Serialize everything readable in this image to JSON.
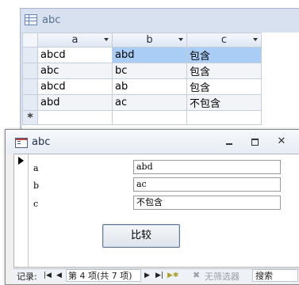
{
  "table_window": {
    "title": "abc",
    "columns": [
      "a",
      "b",
      "c"
    ],
    "rows": [
      [
        "abcd",
        "abd",
        "包含"
      ],
      [
        "abc",
        "bc",
        "包含"
      ],
      [
        "abcd",
        "ab",
        "包含"
      ],
      [
        "abd",
        "ac",
        "不包含"
      ]
    ],
    "new_row_marker": "*"
  },
  "form_window": {
    "title": "abc",
    "close_glyph": "✕",
    "fields": [
      {
        "label": "a",
        "value": "abd"
      },
      {
        "label": "b",
        "value": "ac"
      },
      {
        "label": "c",
        "value": "不包含"
      }
    ],
    "compare_button": "比较"
  },
  "nav_bar": {
    "record_label": "记录:",
    "first": "|◀",
    "prev": "◀",
    "position": "第 4 项(共 7 项)",
    "next": "▶",
    "last": "▶|",
    "new": "▶✱",
    "filter_label": "无筛选器",
    "filter_icon": "✖",
    "search_label": "搜索"
  }
}
